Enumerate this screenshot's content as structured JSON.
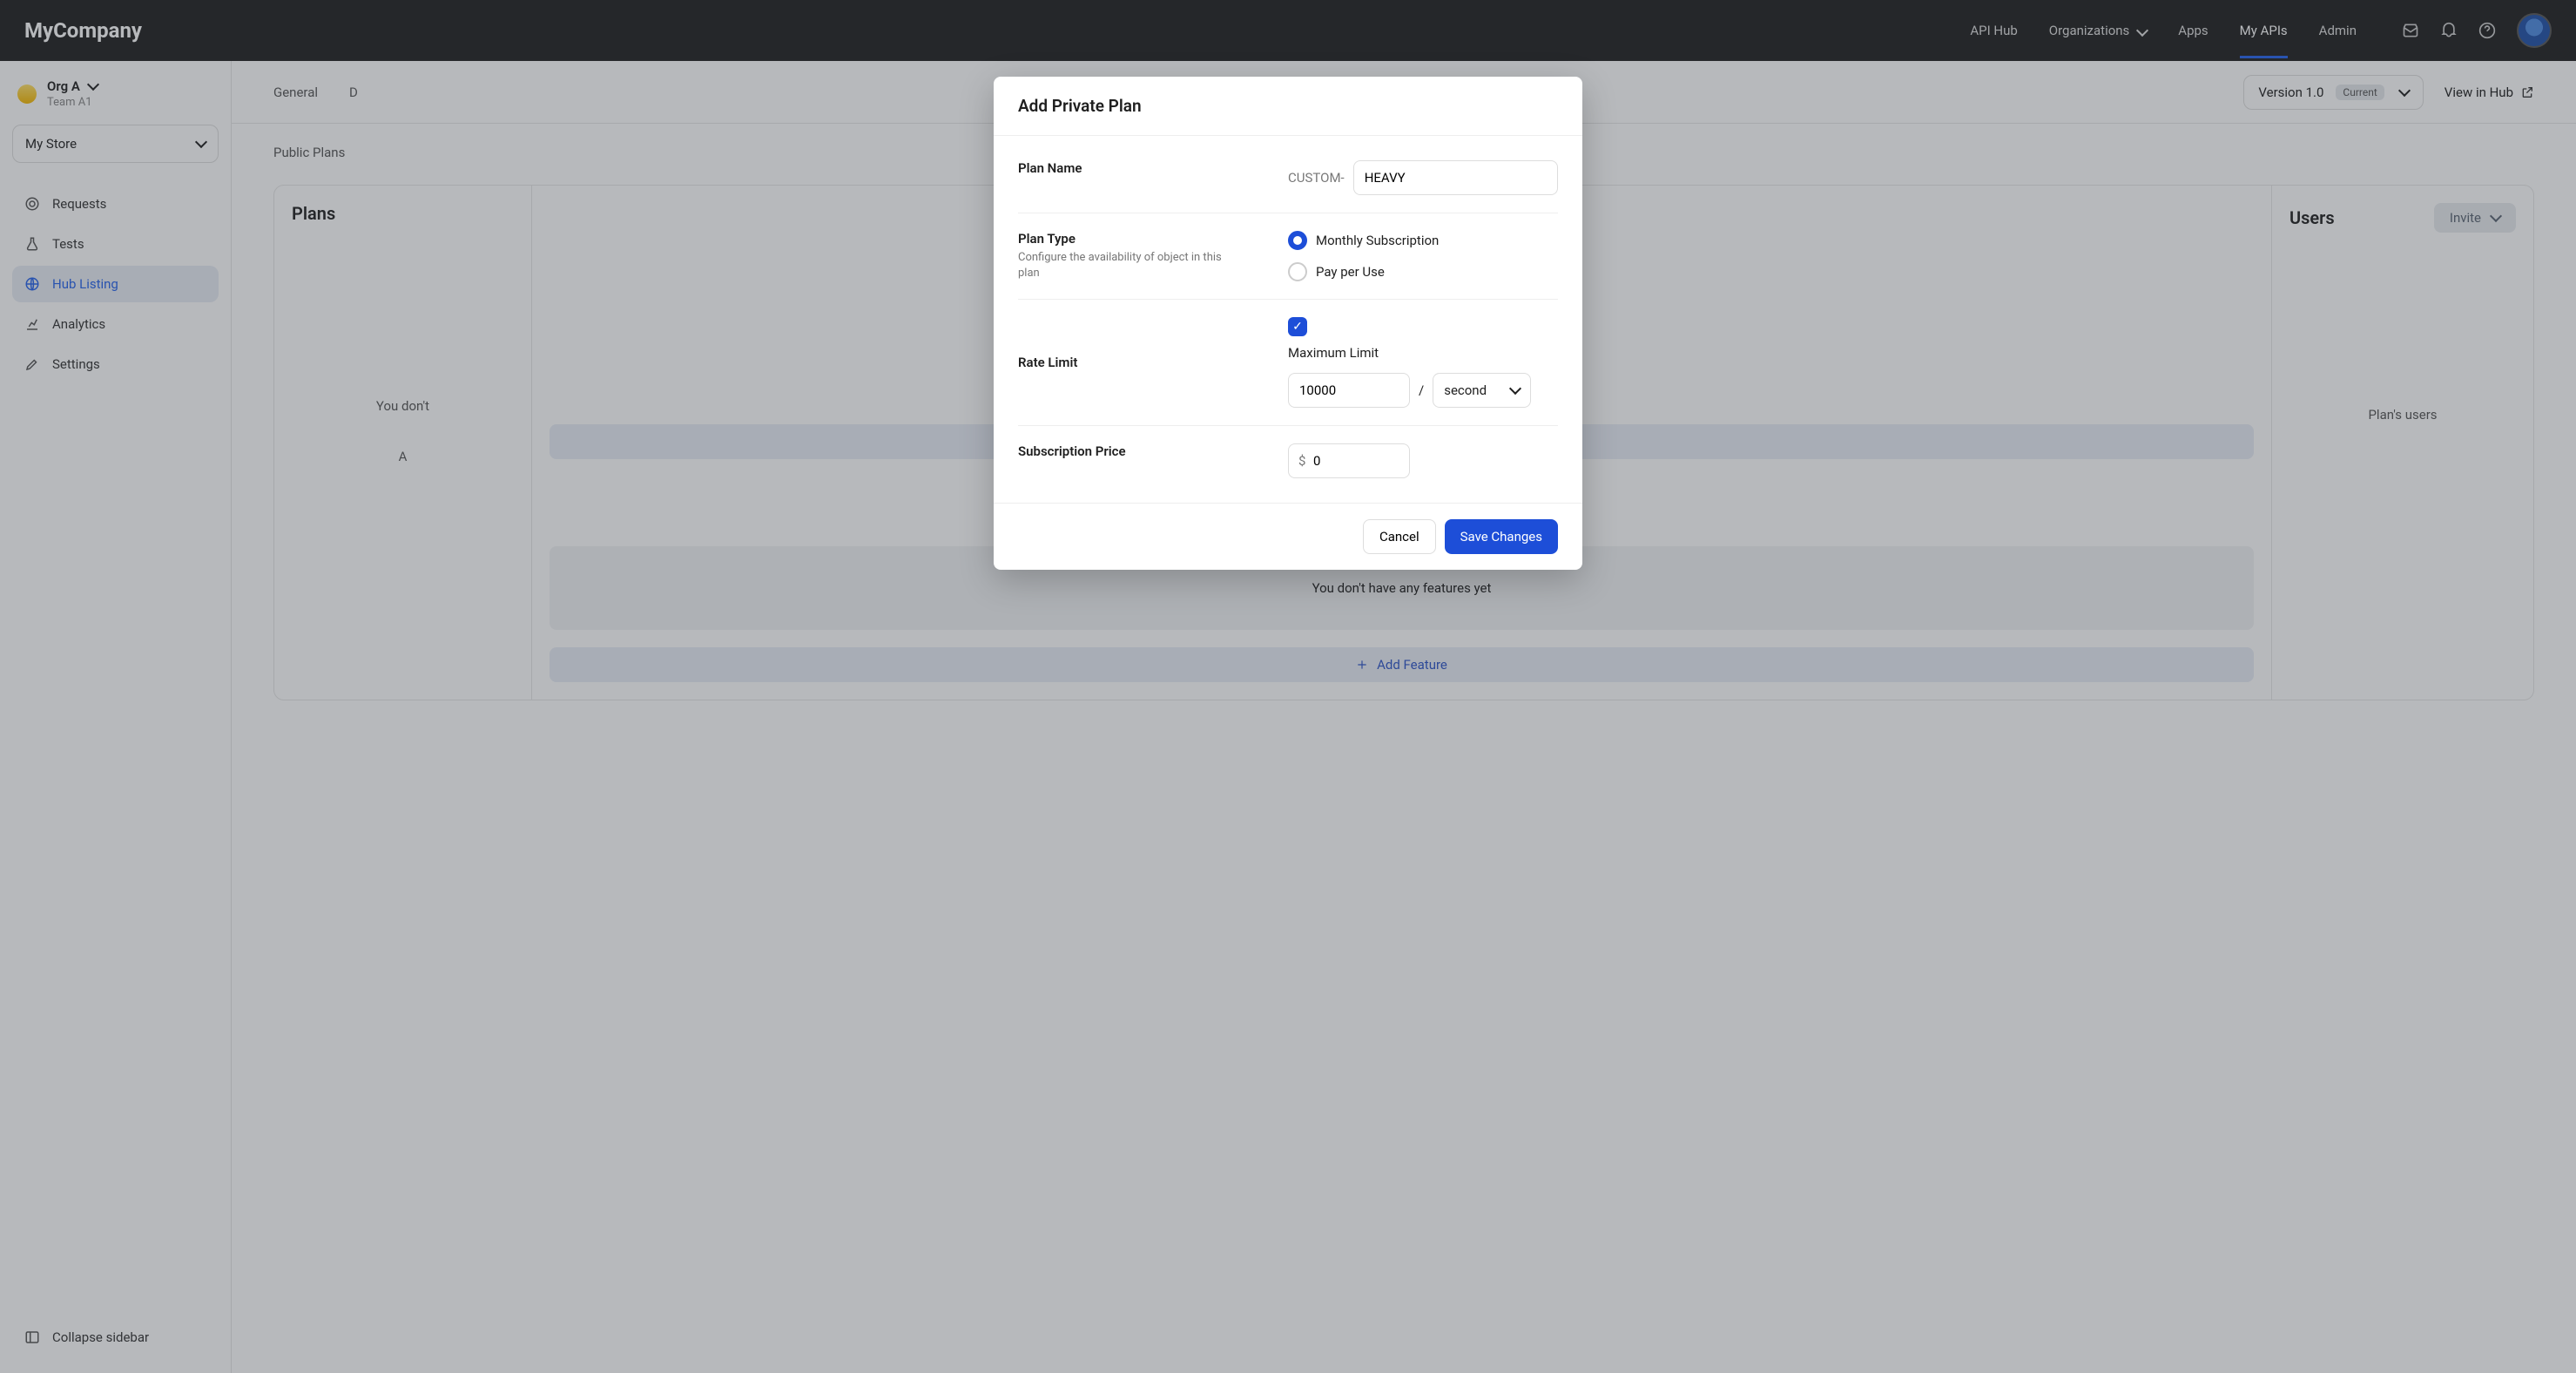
{
  "brand": "MyCompany",
  "topnav": {
    "items": [
      "API Hub",
      "Organizations",
      "Apps",
      "My APIs",
      "Admin"
    ],
    "active_index": 3
  },
  "sidebar": {
    "org_name": "Org A",
    "team_name": "Team A1",
    "store_selector": "My Store",
    "items": [
      {
        "label": "Requests"
      },
      {
        "label": "Tests"
      },
      {
        "label": "Hub Listing"
      },
      {
        "label": "Analytics"
      },
      {
        "label": "Settings"
      }
    ],
    "active_index": 2,
    "collapse": "Collapse sidebar"
  },
  "main_tabs": {
    "items": [
      "General",
      "D"
    ],
    "version_label": "Version 1.0",
    "version_badge": "Current",
    "view_hub": "View in Hub"
  },
  "sub_tabs": {
    "items": [
      "Public Plans"
    ]
  },
  "panels": {
    "plans_title": "Plans",
    "plans_empty_1": "You don't",
    "plans_empty_2": "",
    "add_plan": "A",
    "users_title": "Users",
    "invite": "Invite",
    "users_empty": "Plan's users",
    "features_empty": "You don't have any features yet",
    "add_feature": "Add Feature"
  },
  "modal": {
    "title": "Add Private Plan",
    "plan_name_label": "Plan Name",
    "plan_name_prefix": "CUSTOM-",
    "plan_name_value": "HEAVY",
    "plan_type_label": "Plan Type",
    "plan_type_sub": "Configure the availability of object in this plan",
    "plan_type_options": [
      "Monthly Subscription",
      "Pay per Use"
    ],
    "plan_type_selected": 0,
    "rate_limit_label": "Rate Limit",
    "rate_limit_checked": true,
    "rate_limit_max_label": "Maximum Limit",
    "rate_limit_value": "10000",
    "rate_limit_sep": "/",
    "rate_limit_unit": "second",
    "price_label": "Subscription Price",
    "price_value": "0",
    "cancel": "Cancel",
    "save": "Save Changes"
  }
}
